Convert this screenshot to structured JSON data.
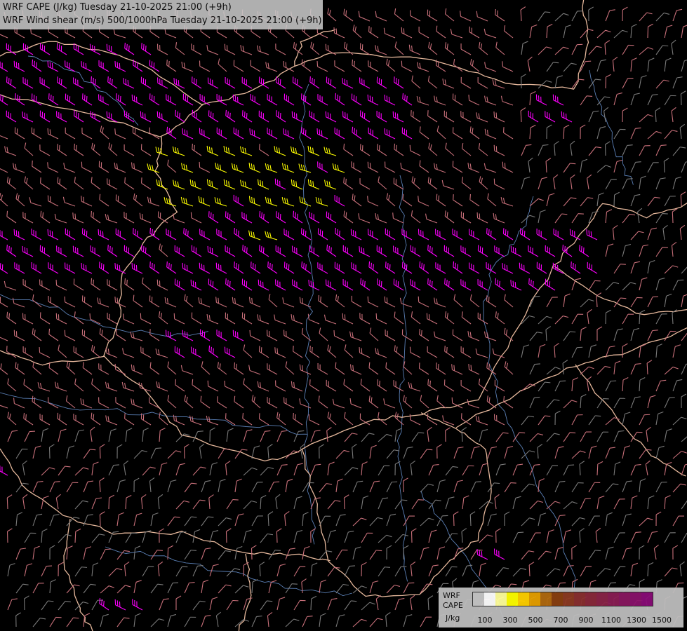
{
  "header": {
    "line1": "WRF CAPE (J/kg) Tuesday 21-10-2025 21:00 (+9h)",
    "line2": "WRF Wind shear (m/s) 500/1000hPa Tuesday 21-10-2025 21:00 (+9h)"
  },
  "legend": {
    "title_1": "WRF",
    "title_2": "CAPE",
    "unit": "J/kg",
    "ticks": [
      "100",
      "300",
      "500",
      "700",
      "900",
      "1100",
      "1300",
      "1500"
    ],
    "swatch_colors": [
      "#c8c8c8",
      "#ffffff",
      "#ffff9a",
      "#ffff00",
      "#ffd000",
      "#e6a000",
      "#b06a10",
      "#8a4010",
      "#8c3a22",
      "#8a3030",
      "#8a2a3c",
      "#8a2448",
      "#8a1e54",
      "#8a1860",
      "#8a126c",
      "#8a0c78"
    ]
  },
  "colors": {
    "background": "#000000",
    "borders": "#e6b89c",
    "rivers": "#5a7fb5",
    "barb_weak": "#7a7a7a",
    "barb_mid": "#c8707a",
    "barb_strong": "#ff00ff",
    "barb_peak": "#ffff00"
  }
}
